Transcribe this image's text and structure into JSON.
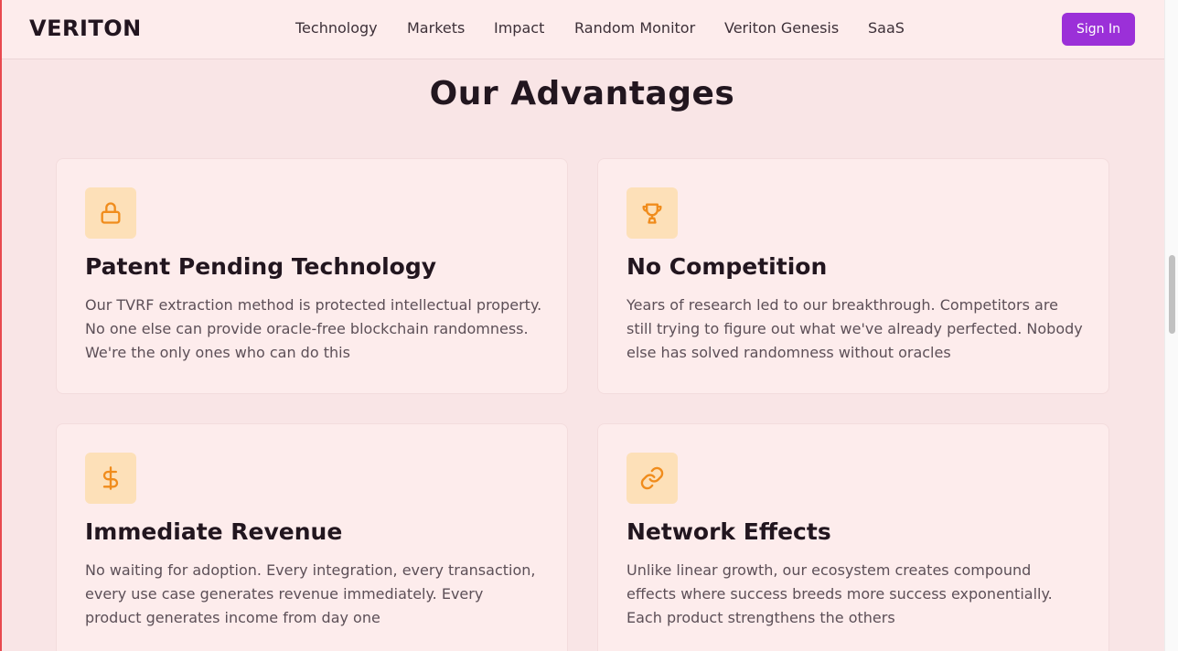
{
  "header": {
    "logo": "VERITON",
    "nav": [
      "Technology",
      "Markets",
      "Impact",
      "Random Monitor",
      "Veriton Genesis",
      "SaaS"
    ],
    "signin_label": "Sign In"
  },
  "section": {
    "title": "Our Advantages",
    "cards": [
      {
        "icon": "lock-icon",
        "title": "Patent Pending Technology",
        "text": "Our TVRF extraction method is protected intellectual property. No one else can provide oracle-free blockchain randomness. We're the only ones who can do this"
      },
      {
        "icon": "trophy-icon",
        "title": "No Competition",
        "text": "Years of research led to our breakthrough. Competitors are still trying to figure out what we've already perfected. Nobody else has solved randomness without oracles"
      },
      {
        "icon": "dollar-icon",
        "title": "Immediate Revenue",
        "text": "No waiting for adoption. Every integration, every transaction, every use case generates revenue immediately. Every product generates income from day one"
      },
      {
        "icon": "link-icon",
        "title": "Network Effects",
        "text": "Unlike linear growth, our ecosystem creates compound effects where success breeds more success exponentially. Each product strengthens the others"
      }
    ]
  },
  "colors": {
    "accent": "#9b30d8",
    "icon": "#f08c1c",
    "icon_bg": "#fde0b8"
  }
}
